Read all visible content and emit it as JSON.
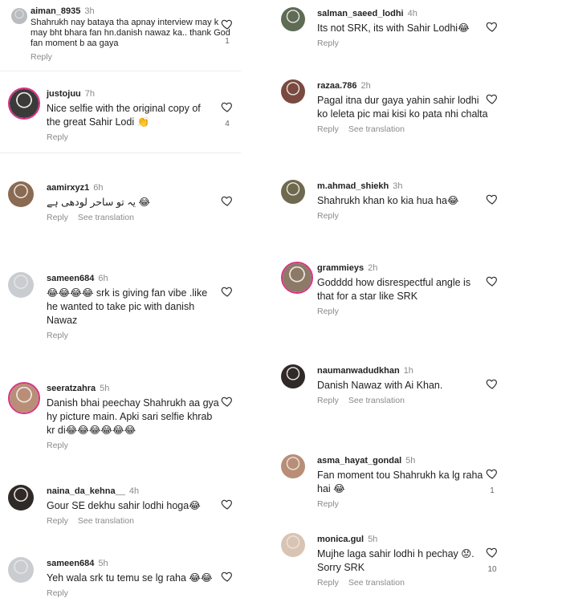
{
  "labels": {
    "reply": "Reply",
    "see_translation": "See translation"
  },
  "left": [
    {
      "user": "aiman_8935",
      "time": "3h",
      "text": "Shahrukh nay bataya tha apnay interview may k\nmay bht bhara fan hn.danish nawaz ka.. thank God\nfan moment b aa gaya",
      "likes": "1",
      "translation": false,
      "ring": false,
      "avatar": "gray"
    },
    {
      "user": "justojuu",
      "time": "7h",
      "text": "Nice selfie with the original copy of\nthe great Sahir Lodi 👏",
      "likes": "4",
      "translation": false,
      "ring": true,
      "avatar": "bw"
    },
    {
      "user": "aamirxyz1",
      "time": "6h",
      "text": "یہ تو ساحر لودھی ہے 😂",
      "likes": "",
      "translation": true,
      "ring": false,
      "avatar": "brown"
    },
    {
      "user": "sameen684",
      "time": "6h",
      "text": "😂😂😂😂 srk is giving fan vibe .like\nhe wanted to take pic with danish\nNawaz",
      "likes": "",
      "translation": false,
      "ring": false,
      "avatar": "lightgray"
    },
    {
      "user": "seeratzahra",
      "time": "5h",
      "text": "Danish bhai peechay Shahrukh aa gya\nhy picture main. Apki sari selfie khrab\nkr di😂😂😂😂😂😂",
      "likes": "",
      "translation": false,
      "ring": true,
      "avatar": "warm"
    },
    {
      "user": "naina_da_kehna__",
      "time": "4h",
      "text": "Gour SE dekhu sahir lodhi hoga😂",
      "likes": "",
      "translation": true,
      "ring": false,
      "avatar": "dark"
    },
    {
      "user": "sameen684",
      "time": "5h",
      "text": "Yeh wala srk tu temu se lg raha 😂😂",
      "likes": "",
      "translation": false,
      "ring": false,
      "avatar": "lightgray"
    }
  ],
  "right": [
    {
      "user": "salman_saeed_lodhi",
      "time": "4h",
      "text": "Its not SRK, its with Sahir Lodhi😂",
      "likes": "",
      "translation": false,
      "ring": false,
      "avatar": "green"
    },
    {
      "user": "razaa.786",
      "time": "2h",
      "text": "Pagal itna dur gaya yahin sahir lodhi\nko leleta pic mai kisi ko pata nhi chalta",
      "likes": "",
      "translation": true,
      "ring": false,
      "avatar": "red"
    },
    {
      "user": "m.ahmad_shiekh",
      "time": "3h",
      "text": "Shahrukh khan ko kia hua ha😂",
      "likes": "",
      "translation": false,
      "ring": false,
      "avatar": "olive"
    },
    {
      "user": "grammieys",
      "time": "2h",
      "text": "Godddd how disrespectful angle is\nthat for a star like SRK",
      "likes": "",
      "translation": false,
      "ring": true,
      "avatar": "building"
    },
    {
      "user": "naumanwadudkhan",
      "time": "1h",
      "text": "Danish Nawaz with Ai Khan.",
      "likes": "",
      "translation": true,
      "ring": false,
      "avatar": "dark"
    },
    {
      "user": "asma_hayat_gondal",
      "time": "5h",
      "text": "Fan moment tou Shahrukh ka lg raha\nhai 😂",
      "likes": "1",
      "translation": false,
      "ring": false,
      "avatar": "warm"
    },
    {
      "user": "monica.gul",
      "time": "5h",
      "text": "Mujhe laga sahir lodhi h pechay 😟.\nSorry SRK",
      "likes": "10",
      "translation": true,
      "ring": false,
      "avatar": "pale"
    }
  ],
  "colors": {
    "gray": "#b9bcc0",
    "bw": "#3a3a3a",
    "brown": "#8a6a52",
    "lightgray": "#c9cdd1",
    "warm": "#b98e77",
    "dark": "#2f2a28",
    "green": "#5e6b55",
    "red": "#7a4a40",
    "olive": "#6f6a4f",
    "building": "#8c7a66",
    "pale": "#d9c4b3",
    "ring": "#d63384",
    "heart": "#333333"
  }
}
